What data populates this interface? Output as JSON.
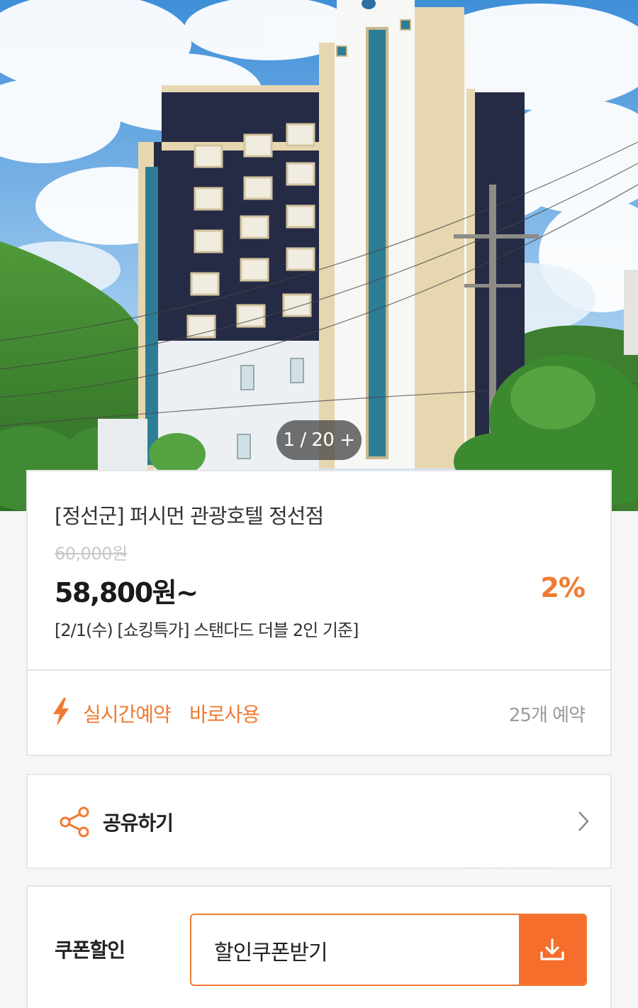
{
  "gallery": {
    "counter": "1 / 20 +"
  },
  "hotel": {
    "name": "[정선군] 퍼시먼 관광호텔 정선점",
    "original_price": "60,000원",
    "sale_price": "58,800원~",
    "discount": "2%",
    "room_desc": "[2/1(수) [쇼킹특가] 스탠다드 더블 2인 기준]"
  },
  "features": {
    "icon": "bolt-icon",
    "items": [
      "실시간예약",
      "바로사용"
    ],
    "booking_count": "25개 예약"
  },
  "share": {
    "icon": "share-icon",
    "label": "공유하기"
  },
  "coupon": {
    "label": "쿠폰할인",
    "button_label": "할인쿠폰받기",
    "button_icon": "download-icon"
  },
  "colors": {
    "accent": "#f07a32",
    "coupon_button": "#f56e2c",
    "building_dark": "#262b45",
    "window_blue": "#2d7d96"
  }
}
